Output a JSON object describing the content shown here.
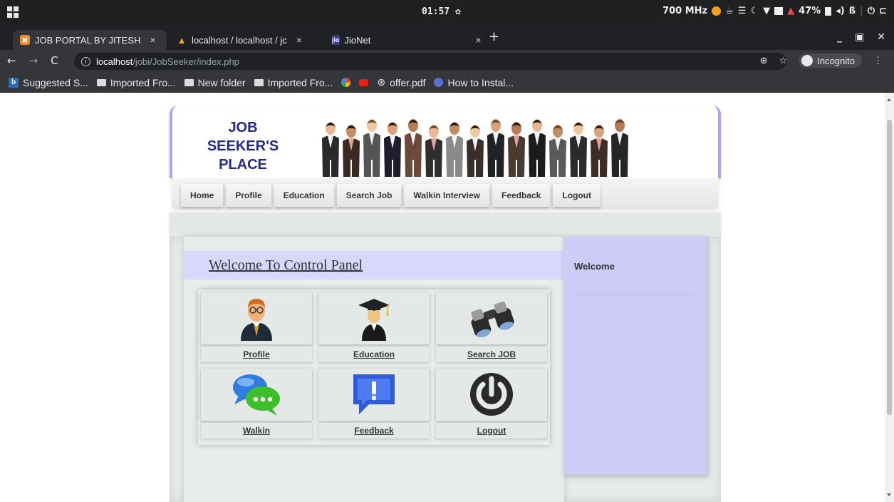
{
  "os_bar": {
    "clock": "01:57",
    "cpu": "700 MHz",
    "battery": "47%"
  },
  "tabs": [
    {
      "label": "JOB PORTAL BY JITESH",
      "close": "×"
    },
    {
      "label": "localhost / localhost / jc",
      "close": "×"
    },
    {
      "label": "JioNet",
      "close": "×"
    }
  ],
  "new_tab": "+",
  "address": {
    "host": "localhost",
    "path": "/jobi/JobSeeker/index.php",
    "incognito": "Incognito"
  },
  "bookmarks": [
    {
      "label": "Suggested S...",
      "icon": "bing-icon"
    },
    {
      "label": "Imported Fro...",
      "icon": "folder-icon"
    },
    {
      "label": "New folder",
      "icon": "folder-icon"
    },
    {
      "label": "Imported Fro...",
      "icon": "folder-icon"
    },
    {
      "label": "offer.pdf",
      "icon": "globe-icon"
    },
    {
      "label": "How to Instal...",
      "icon": "globe-icon"
    }
  ],
  "site": {
    "logo_lines": [
      "JOB",
      "SEEKER'S",
      "PLACE"
    ],
    "menu": [
      "Home",
      "Profile",
      "Education",
      "Search Job",
      "Walkin Interview",
      "Feedback",
      "Logout"
    ],
    "welcome_heading": "Welcome To Control Panel",
    "panels": [
      {
        "label": "Profile",
        "icon": "businessman-icon"
      },
      {
        "label": "Education",
        "icon": "graduate-icon"
      },
      {
        "label": "Search JOB",
        "icon": "binoculars-icon"
      },
      {
        "label": "Walkin",
        "icon": "chat-bubbles-icon"
      },
      {
        "label": "Feedback",
        "icon": "feedback-icon"
      },
      {
        "label": "Logout",
        "icon": "power-icon"
      }
    ],
    "sidebar_title": "Welcome"
  },
  "colors": {
    "menu_accent": "#d8d8fd",
    "sidebar": "#ccccf6",
    "logo_text": "#24288a"
  }
}
